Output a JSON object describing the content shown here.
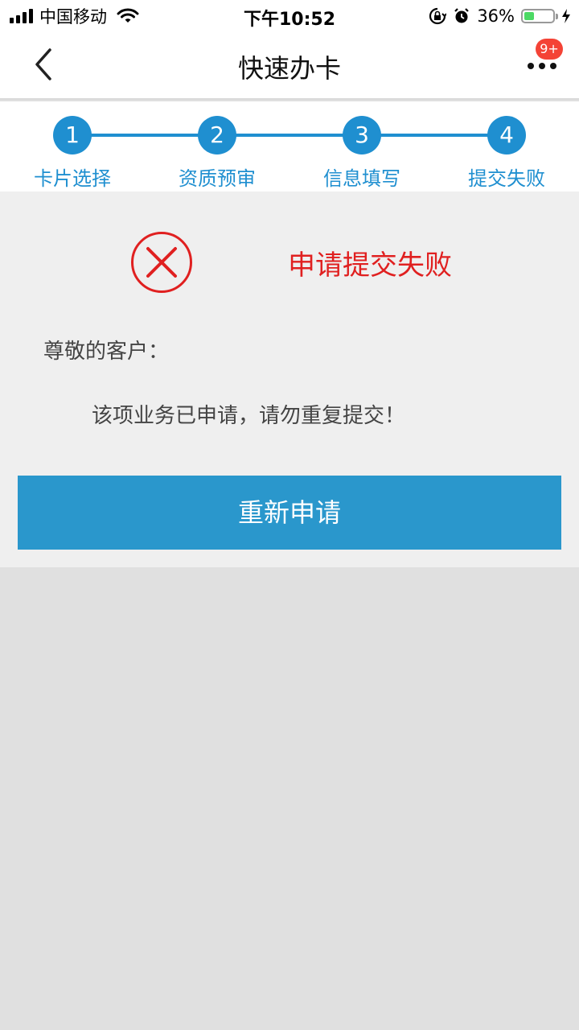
{
  "status_bar": {
    "carrier": "中国移动",
    "time": "下午10:52",
    "battery_percent": "36%",
    "battery_level": 0.36,
    "icons": [
      "signal-icon",
      "wifi-icon",
      "rotation-lock-icon",
      "alarm-icon",
      "battery-icon",
      "charging-icon"
    ]
  },
  "nav": {
    "title": "快速办卡",
    "badge": "9+",
    "back_icon": "chevron-left-icon",
    "more_icon": "more-dots-icon"
  },
  "steps": [
    {
      "number": "1",
      "label": "卡片选择"
    },
    {
      "number": "2",
      "label": "资质预审"
    },
    {
      "number": "3",
      "label": "信息填写"
    },
    {
      "number": "4",
      "label": "提交失败"
    }
  ],
  "result": {
    "icon": "error-circle-x-icon",
    "title": "申请提交失败",
    "greeting": "尊敬的客户：",
    "message": "该项业务已申请，请勿重复提交！",
    "button_label": "重新申请"
  },
  "colors": {
    "accent": "#1f8fd0",
    "button": "#2a97cc",
    "error": "#e02020",
    "badge": "#f44336"
  }
}
